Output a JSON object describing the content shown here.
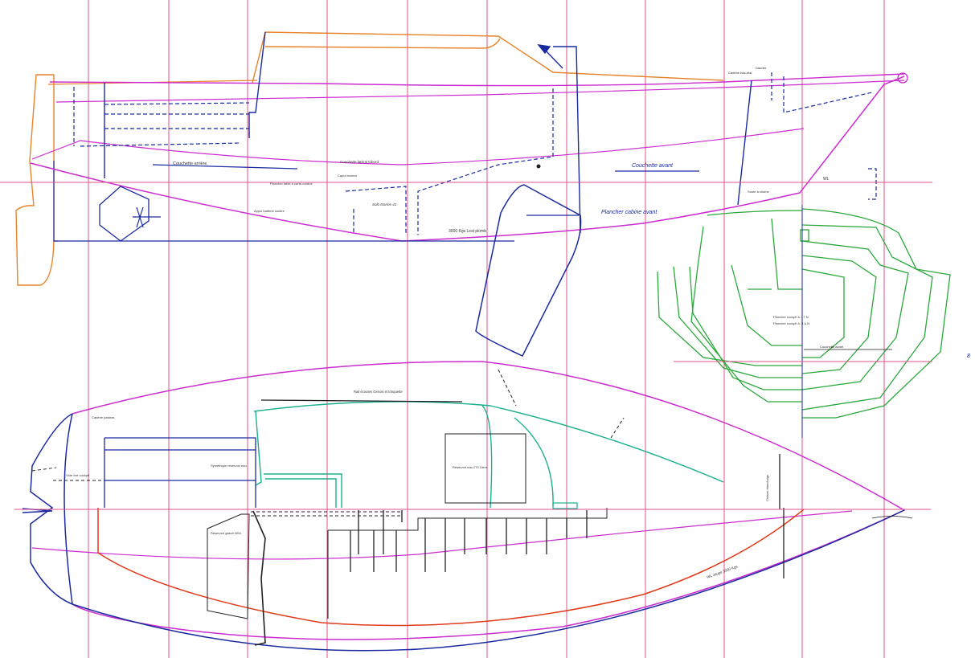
{
  "labels": {
    "couchette_arriere": "Couchette arrière",
    "couchette_laterale": "Couchette latéral tribord",
    "couchette_avant": "Couchette avant",
    "plancher_cabine_avant": "Plancher cabine avant",
    "plancher_table": "Plancher table à carte-cuisine",
    "capot_moteur": "Capot moteur",
    "solo_marine": "Solo Marine 41",
    "appui_batterie": "Appui batterie soutire",
    "lest_plomb": "3000 Kgs  Lest  plomb",
    "daudet": "Daudet",
    "cadene_bas_etai": "Cadène bas-étai",
    "soute_chaine": "Soute à chaîne",
    "wl_short": "WL",
    "rail_ecoutes": "Rail écoutes Genois et trinquette",
    "cadene_pataras": "Cadène pataras",
    "vide_cockpit": "Vide vire cockpit",
    "symetrique_reservoir": "Symétrique réservoir eau",
    "reservoir_eau": "Réservoir eau 270 Litres",
    "reservoir_gasoil": "Réservoir gasoil 400L",
    "cloison_etanche": "Cloison étanchage",
    "wl_3000": "WL Jauge 3000 Kgs",
    "plancher_cockpit_1": "Plancher cockpit à -17 N",
    "plancher_cockpit_2": "Plancher cockpit à -3 & N",
    "couchette_avant_section": "Couchette avant",
    "edge_mark": "8"
  },
  "colors": {
    "grid": "#e0508a",
    "hull_outline": "#1a2aa0",
    "sheer_magenta": "#cc2bd0",
    "deck_orange": "#e8822a",
    "interior_green": "#18b08a",
    "section_green": "#2aa83a",
    "waterline_red": "#e03a1a",
    "ink": "#222222"
  }
}
